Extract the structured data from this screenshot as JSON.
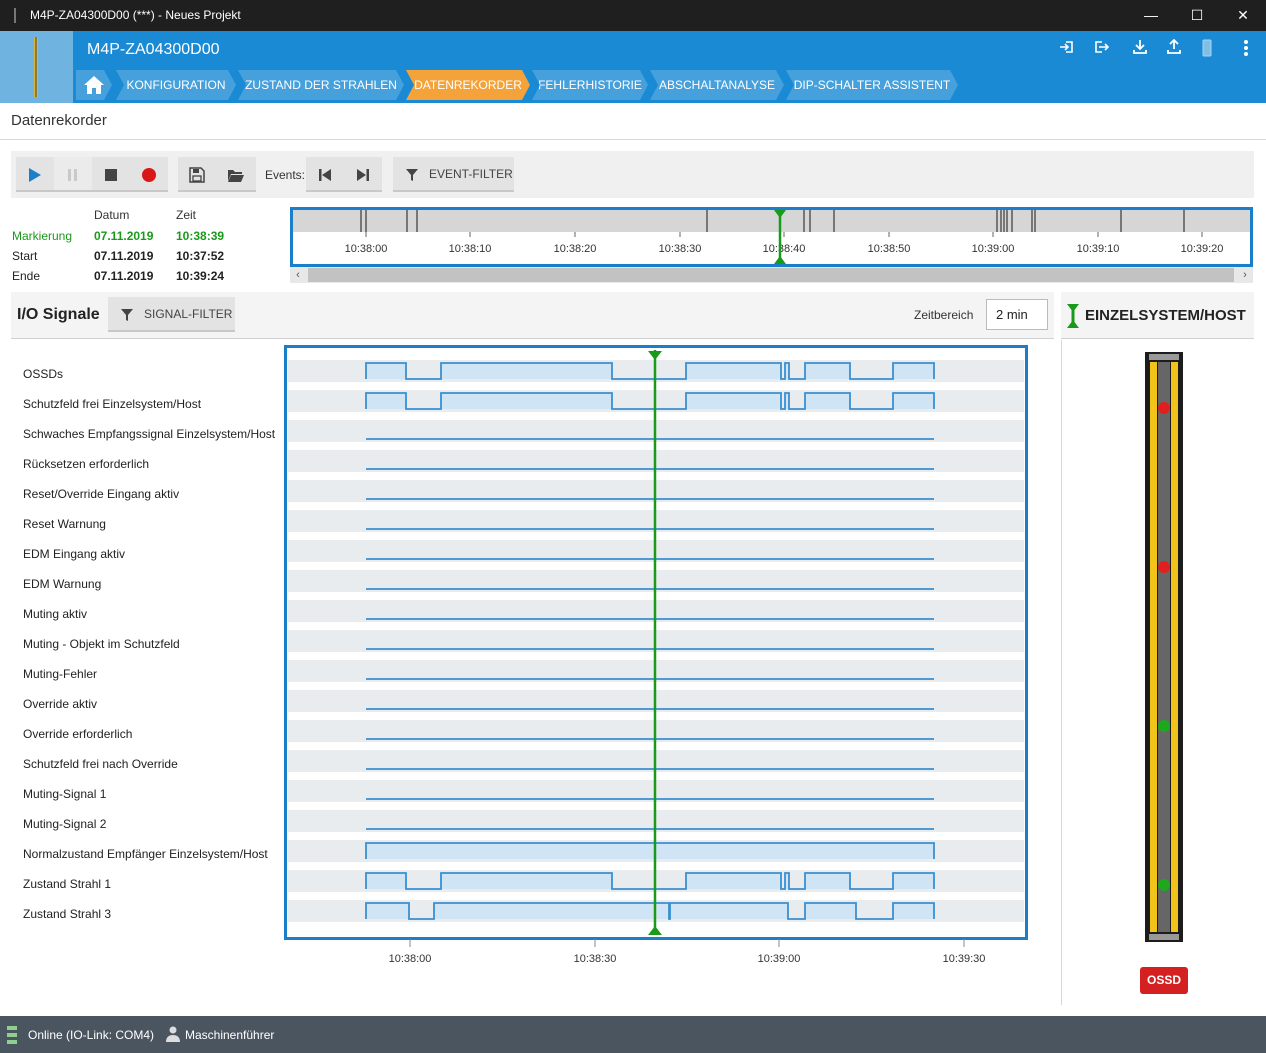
{
  "window": {
    "title": "M4P-ZA04300D00 (***) - Neues Projekt",
    "minimize": "—",
    "maximize": "☐",
    "close": "✕"
  },
  "header": {
    "project": "M4P-ZA04300D00",
    "icons": [
      "login-icon",
      "logout-icon",
      "download-icon",
      "upload-icon",
      "device-icon",
      "more-icon"
    ]
  },
  "tabs": [
    {
      "label": "",
      "icon": "home-icon"
    },
    {
      "label": "KONFIGURATION"
    },
    {
      "label": "ZUSTAND DER STRAHLEN"
    },
    {
      "label": "DATENREKORDER",
      "active": true
    },
    {
      "label": "FEHLERHISTORIE"
    },
    {
      "label": "ABSCHALTANALYSE"
    },
    {
      "label": "DIP-SCHALTER ASSISTENT"
    }
  ],
  "page_title": "Datenrekorder",
  "toolbar": {
    "events_label": "Events:",
    "event_filter": "EVENT-FILTER",
    "buttons": [
      "play-icon",
      "pause-icon",
      "stop-icon",
      "record-icon",
      "save-icon",
      "open-icon",
      "prev-event-icon",
      "next-event-icon",
      "filter-icon"
    ]
  },
  "marker": {
    "col_datum": "Datum",
    "col_zeit": "Zeit",
    "rows": [
      {
        "label": "Markierung",
        "datum": "07.11.2019",
        "zeit": "10:38:39"
      },
      {
        "label": "Start",
        "datum": "07.11.2019",
        "zeit": "10:37:52"
      },
      {
        "label": "Ende",
        "datum": "07.11.2019",
        "zeit": "10:39:24"
      }
    ]
  },
  "overview": {
    "ticks": [
      "10:38:00",
      "10:38:10",
      "10:38:20",
      "10:38:30",
      "10:38:40",
      "10:38:50",
      "10:39:00",
      "10:39:10",
      "10:39:20"
    ],
    "marker_time": "10:38:39"
  },
  "io": {
    "title": "I/O Signale",
    "signal_filter": "SIGNAL-FILTER",
    "zeitbereich_label": "Zeitbereich",
    "zeitbereich_value": "2 min",
    "time_ticks": [
      "10:38:00",
      "10:38:30",
      "10:39:00",
      "10:39:30"
    ],
    "signals": [
      "OSSDs",
      "Schutzfeld frei Einzelsystem/Host",
      "Schwaches Empfangssignal Einzelsystem/Host",
      "Rücksetzen erforderlich",
      "Reset/Override Eingang aktiv",
      "Reset Warnung",
      "EDM Eingang aktiv",
      "EDM Warnung",
      "Muting aktiv",
      "Muting - Objekt im Schutzfeld",
      "Muting-Fehler",
      "Override aktiv",
      "Override erforderlich",
      "Schutzfeld frei nach Override",
      "Muting-Signal 1",
      "Muting-Signal 2",
      "Normalzustand Empfänger Einzelsystem/Host",
      "Zustand Strahl 1",
      "Zustand Strahl 3"
    ]
  },
  "right_panel": {
    "title": "EINZELSYSTEM/HOST",
    "ossd_badge": "OSSD"
  },
  "status": {
    "connection": "Online (IO-Link: COM4)",
    "user": "Maschinenführer"
  },
  "colors": {
    "accent": "#1a8ad4",
    "active_tab": "#f4a23a",
    "marker": "#1a9a1a",
    "signal": "#3a8fd0",
    "signal_fill": "#cfe4f4",
    "ossd_red": "#d42020"
  }
}
